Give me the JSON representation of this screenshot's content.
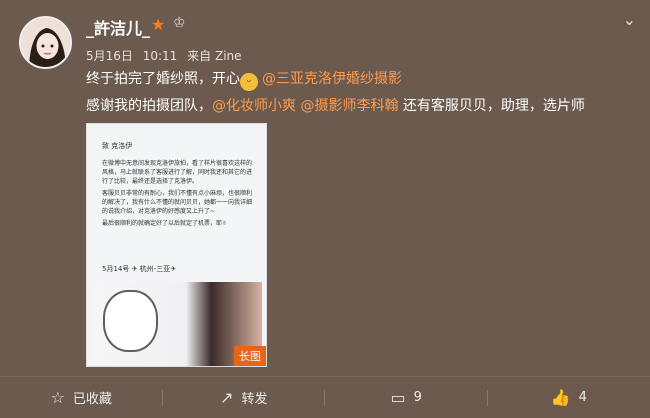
{
  "post": {
    "username": "_許洁儿_",
    "badge_star": "★",
    "badge_crown": "♔",
    "date": "5月16日",
    "time": "10:11",
    "source": "来自 Zine",
    "line1_text": "终于拍完了婚纱照，开心",
    "line1_mention": "@三亚克洛伊婚纱摄影",
    "line2_text1": "感谢我的拍摄团队，",
    "line2_mention1": "@化妆师小爽",
    "line2_mention2": "@摄影师李科翰",
    "line2_text2": " 还有客服贝贝，助理，选片师",
    "image_tag": "长图"
  },
  "image": {
    "header": "致 克洛伊",
    "paragraphs": [
      "在微博中无意间发现克洛伊旅拍，看了样片很喜欢这样的风格，马上就联系了客服进行了解，同时我还和其它的进行了比较，最终还是选择了克洛伊。",
      "客服贝贝非常的有耐心，我们不懂有点小麻烦，也很顺利的解决了，我有什么不懂的就问贝贝，她都一一向我详细的说我介绍，对克洛伊的好感度又上升了~",
      "最后很顺利的就确定好了以后就定了机票，耶✌"
    ],
    "date_line": "5月14号 ✈ 杭州-三亚✈"
  },
  "actions": [
    {
      "icon": "☆",
      "label": "已收藏"
    },
    {
      "icon": "↗",
      "label": "转发"
    },
    {
      "icon": "▭",
      "label": "9"
    },
    {
      "icon": "👍",
      "label": "4"
    }
  ],
  "colors": {
    "background": "#6b5a4d",
    "mention": "#ff9b4d",
    "badge_star": "#ff7e1a",
    "long_image_tag": "#e6651b"
  }
}
